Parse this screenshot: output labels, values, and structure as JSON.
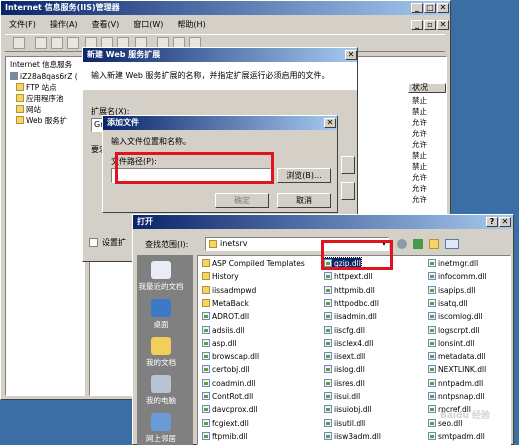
{
  "iis": {
    "title": "Internet 信息服务(IIS)管理器",
    "menu": [
      "文件(F)",
      "操作(A)",
      "查看(V)",
      "窗口(W)",
      "帮助(H)"
    ],
    "tree_header": "Internet 信息服务",
    "tree": [
      "iZ28a8qas6rZ (",
      "FTP 站点",
      "应用程序池",
      "网站",
      "Web 服务扩"
    ],
    "status_header": "状况",
    "status": [
      "禁止",
      "禁止",
      "允许",
      "允许",
      "允许",
      "禁止",
      "禁止",
      "允许",
      "允许",
      "允许"
    ]
  },
  "newext": {
    "title": "新建 Web 服务扩展",
    "desc": "输入新建 Web 服务扩展的名称，并指定扩展运行必须启用的文件。",
    "name_label": "扩展名(X):",
    "name_value": "Gr",
    "req_label": "要求",
    "status_check": "设置扩"
  },
  "addfile": {
    "title": "添加文件",
    "desc": "输入文件位置和名称。",
    "path_label": "文件路径(P):",
    "path_value": "",
    "browse": "浏览(B)...",
    "ok": "确定",
    "cancel": "取消"
  },
  "open": {
    "title": "打开",
    "lookin_label": "查找范围(I):",
    "lookin_value": "inetsrv",
    "places": [
      "我最近的文档",
      "桌面",
      "我的文档",
      "我的电脑",
      "网上邻居"
    ],
    "col1": [
      {
        "n": "ASP Compiled Templates",
        "t": "folder"
      },
      {
        "n": "History",
        "t": "folder"
      },
      {
        "n": "iissadmpwd",
        "t": "folder"
      },
      {
        "n": "MetaBack",
        "t": "folder"
      },
      {
        "n": "ADROT.dll",
        "t": "dll"
      },
      {
        "n": "adsiis.dll",
        "t": "dll"
      },
      {
        "n": "asp.dll",
        "t": "dll"
      },
      {
        "n": "browscap.dll",
        "t": "dll"
      },
      {
        "n": "certobj.dll",
        "t": "dll"
      },
      {
        "n": "coadmin.dll",
        "t": "dll"
      },
      {
        "n": "ContRot.dll",
        "t": "dll"
      },
      {
        "n": "davcprox.dll",
        "t": "dll"
      },
      {
        "n": "fcgiext.dll",
        "t": "dll"
      },
      {
        "n": "ftpmib.dll",
        "t": "dll"
      }
    ],
    "col2": [
      {
        "n": "gzip.dll",
        "t": "dll"
      },
      {
        "n": "httpext.dll",
        "t": "dll"
      },
      {
        "n": "httpmib.dll",
        "t": "dll"
      },
      {
        "n": "httpodbc.dll",
        "t": "dll"
      },
      {
        "n": "iisadmin.dll",
        "t": "dll"
      },
      {
        "n": "iiscfg.dll",
        "t": "dll"
      },
      {
        "n": "iisclex4.dll",
        "t": "dll"
      },
      {
        "n": "iisext.dll",
        "t": "dll"
      },
      {
        "n": "iislog.dll",
        "t": "dll"
      },
      {
        "n": "iisres.dll",
        "t": "dll"
      },
      {
        "n": "iisui.dll",
        "t": "dll"
      },
      {
        "n": "iisuiobj.dll",
        "t": "dll"
      },
      {
        "n": "iisutil.dll",
        "t": "dll"
      },
      {
        "n": "iisw3adm.dll",
        "t": "dll"
      }
    ],
    "col3": [
      {
        "n": "inetmgr.dll",
        "t": "dll"
      },
      {
        "n": "infocomm.dll",
        "t": "dll"
      },
      {
        "n": "isapips.dll",
        "t": "dll"
      },
      {
        "n": "isatq.dll",
        "t": "dll"
      },
      {
        "n": "iscomlog.dll",
        "t": "dll"
      },
      {
        "n": "logscrpt.dll",
        "t": "dll"
      },
      {
        "n": "lonsint.dll",
        "t": "dll"
      },
      {
        "n": "metadata.dll",
        "t": "dll"
      },
      {
        "n": "NEXTLINK.dll",
        "t": "dll"
      },
      {
        "n": "nntpadm.dll",
        "t": "dll"
      },
      {
        "n": "nntpsnap.dll",
        "t": "dll"
      },
      {
        "n": "rpcref.dll",
        "t": "dll"
      },
      {
        "n": "seo.dll",
        "t": "dll"
      },
      {
        "n": "smtpadm.dll",
        "t": "dll"
      }
    ]
  },
  "watermark": "Baidu 经验"
}
